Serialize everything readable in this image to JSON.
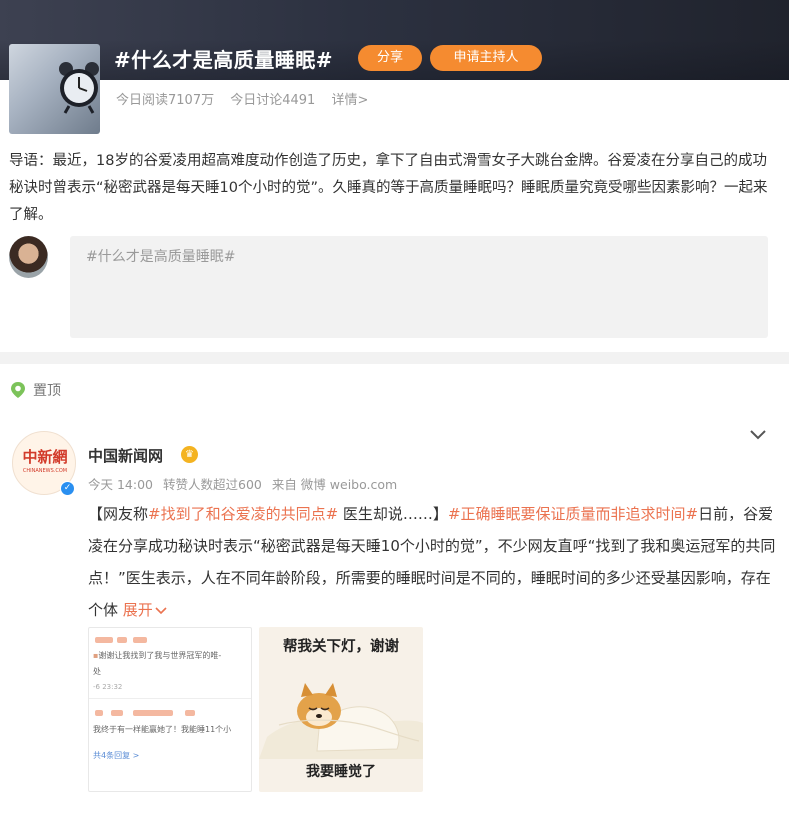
{
  "topic": {
    "title": "#什么才是高质量睡眠#",
    "share_label": "分享",
    "host_label": "申请主持人",
    "reads": "今日阅读7107万",
    "discussions": "今日讨论4491",
    "details": "详情>"
  },
  "intro": {
    "text": "导语：最近，18岁的谷爱凌用超高难度动作创造了历史，拿下了自由式滑雪女子大跳台金牌。谷爱凌在分享自己的成功秘诀时曾表示“秘密武器是每天睡10个小时的觉”。久睡真的等于高质量睡眠吗？睡眠质量究竟受哪些因素影响？一起来了解。"
  },
  "comment_box": {
    "placeholder": "#什么才是高质量睡眠#"
  },
  "pinned": {
    "label": "置顶"
  },
  "post": {
    "author": "中国新闻网",
    "avatar_text": "中新網",
    "avatar_subtext": "CHINANEWS.COM",
    "time": "今天 14:00",
    "likes": "转赞人数超过600",
    "source": "来自 微博 weibo.com",
    "text_open": "【网友称",
    "tag1": "#找到了和谷爱凌的共同点#",
    "text_mid": " 医生却说……】",
    "tag2": "#正确睡眠要保证质量而非追求时间#",
    "text_body": "日前，谷爱凌在分享成功秘诀时表示“秘密武器是每天睡10个小时的觉”，不少网友直呼“找到了我和奥运冠军的共同点！”医生表示，人在不同年龄阶段，所需要的睡眠时间是不同的，睡眠时间的多少还受基因影响，存在个体 ",
    "expand": "展开"
  },
  "images": {
    "chat": {
      "line1": "谢谢让我找到了我与世界冠军的唯-",
      "line1_tail": "处",
      "time1": "-6 23:32",
      "line2": "我终于有一样能赢她了！我能睡11个小",
      "replies": "共4条回复 >"
    },
    "meme": {
      "top": "帮我关下灯，谢谢",
      "bottom": "我要睡觉了"
    }
  },
  "colors": {
    "accent": "#f58b30",
    "link": "#eb7350",
    "verified": "#2a8ff0"
  }
}
